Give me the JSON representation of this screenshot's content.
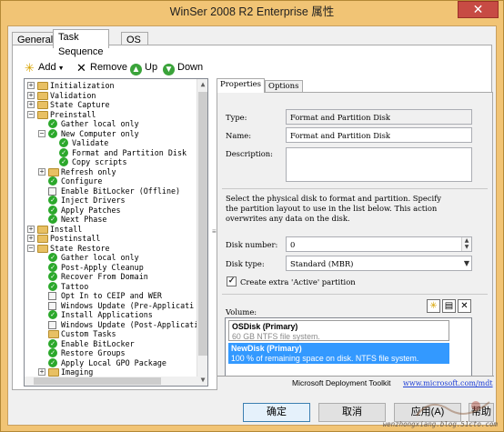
{
  "window": {
    "title": "WinSer 2008 R2 Enterprise 属性",
    "close_glyph": "✕"
  },
  "tabs": [
    "General",
    "Task Sequence",
    "OS Info"
  ],
  "toolbar": {
    "add": "Add",
    "remove": "Remove",
    "up": "Up",
    "down": "Down"
  },
  "tree": [
    {
      "label": "Initialization",
      "level": 0,
      "kind": "folder",
      "expander": "+"
    },
    {
      "label": "Validation",
      "level": 0,
      "kind": "folder",
      "expander": "+"
    },
    {
      "label": "State Capture",
      "level": 0,
      "kind": "folder",
      "expander": "+"
    },
    {
      "label": "Preinstall",
      "level": 0,
      "kind": "folder",
      "expander": "-"
    },
    {
      "label": "Gather local only",
      "level": 1,
      "kind": "check"
    },
    {
      "label": "New Computer only",
      "level": 1,
      "kind": "check",
      "expander": "-"
    },
    {
      "label": "Validate",
      "level": 2,
      "kind": "check"
    },
    {
      "label": "Format and Partition Disk",
      "level": 2,
      "kind": "check"
    },
    {
      "label": "Copy scripts",
      "level": 2,
      "kind": "check"
    },
    {
      "label": "Refresh only",
      "level": 1,
      "kind": "folder",
      "expander": "+"
    },
    {
      "label": "Configure",
      "level": 1,
      "kind": "check"
    },
    {
      "label": "Enable BitLocker (Offline)",
      "level": 1,
      "kind": "plain"
    },
    {
      "label": "Inject Drivers",
      "level": 1,
      "kind": "check"
    },
    {
      "label": "Apply Patches",
      "level": 1,
      "kind": "check"
    },
    {
      "label": "Next Phase",
      "level": 1,
      "kind": "check"
    },
    {
      "label": "Install",
      "level": 0,
      "kind": "folder",
      "expander": "+"
    },
    {
      "label": "Postinstall",
      "level": 0,
      "kind": "folder",
      "expander": "+"
    },
    {
      "label": "State Restore",
      "level": 0,
      "kind": "folder",
      "expander": "-"
    },
    {
      "label": "Gather local only",
      "level": 1,
      "kind": "check"
    },
    {
      "label": "Post-Apply Cleanup",
      "level": 1,
      "kind": "check"
    },
    {
      "label": "Recover From Domain",
      "level": 1,
      "kind": "check"
    },
    {
      "label": "Tattoo",
      "level": 1,
      "kind": "check"
    },
    {
      "label": "Opt In to CEIP and WER",
      "level": 1,
      "kind": "plain"
    },
    {
      "label": "Windows Update (Pre-Applicati",
      "level": 1,
      "kind": "plain"
    },
    {
      "label": "Install Applications",
      "level": 1,
      "kind": "check"
    },
    {
      "label": "Windows Update (Post-Applicati",
      "level": 1,
      "kind": "plain"
    },
    {
      "label": "Custom Tasks",
      "level": 1,
      "kind": "folder"
    },
    {
      "label": "Enable BitLocker",
      "level": 1,
      "kind": "check"
    },
    {
      "label": "Restore Groups",
      "level": 1,
      "kind": "check"
    },
    {
      "label": "Apply Local GPO Package",
      "level": 1,
      "kind": "check"
    },
    {
      "label": "Imaging",
      "level": 1,
      "kind": "folder",
      "expander": "+"
    }
  ],
  "props": {
    "tabs": [
      "Properties",
      "Options"
    ],
    "type_label": "Type:",
    "type_value": "Format and Partition Disk",
    "name_label": "Name:",
    "name_value": "Format and Partition Disk",
    "description_label": "Description:",
    "description_value": "",
    "instructions": [
      "Select the physical disk to format and partition.  Specify",
      "the partition layout to use in the list below. This action",
      "overwrites any data on the disk."
    ],
    "disk_number_label": "Disk number:",
    "disk_number_value": "0",
    "disk_type_label": "Disk type:",
    "disk_type_value": "Standard (MBR)",
    "extra_partition_label": "Create extra 'Active' partition",
    "extra_partition_checked": "✓",
    "volume_label": "Volume:",
    "volumes": [
      {
        "name": "OSDisk (Primary)",
        "info": "60 GB NTFS file system."
      },
      {
        "name": "NewDisk (Primary)",
        "info": "100 % of remaining space on disk. NTFS file system."
      }
    ],
    "footer_text": "Microsoft Deployment Toolkit",
    "footer_link": "www.microsoft.com/mdt"
  },
  "buttons": {
    "ok": "确定",
    "cancel": "取消",
    "apply": "应用(A)",
    "help": "帮助"
  },
  "watermark": "wenzhongxiang.blog.51cto.com"
}
